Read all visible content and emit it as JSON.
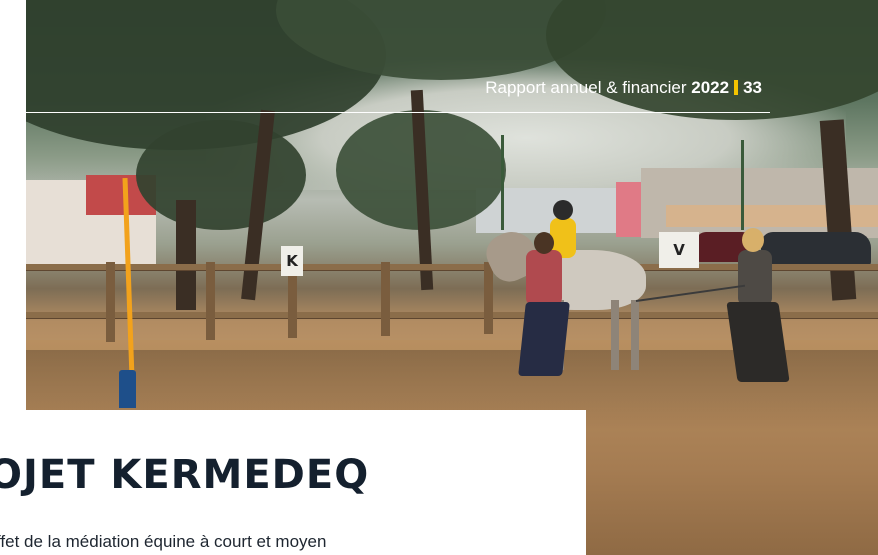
{
  "header": {
    "report_label": "Rapport annuel & financier",
    "year": "2022",
    "page_number": "33",
    "separator_color": "#f5c400"
  },
  "photo": {
    "signs": [
      "K",
      "V"
    ],
    "icon": "equine-mediation-photo"
  },
  "article": {
    "title": "OJET KERMEDEQ",
    "body": "ffet de la médiation équine à court et moyen"
  },
  "colors": {
    "title": "#14202e",
    "body": "#1e2630",
    "header_text": "#ffffff"
  }
}
